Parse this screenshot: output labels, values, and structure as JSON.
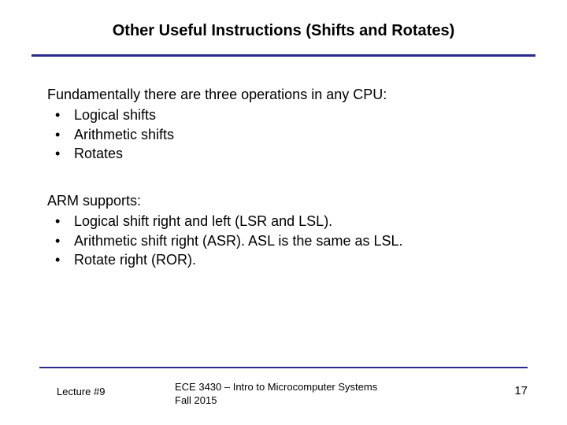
{
  "title": "Other Useful Instructions (Shifts and Rotates)",
  "section1": {
    "intro": "Fundamentally there are three operations in any CPU:",
    "bullets": [
      "Logical shifts",
      "Arithmetic shifts",
      "Rotates"
    ]
  },
  "section2": {
    "intro": "ARM supports:",
    "bullets": [
      "Logical shift right and left (LSR and LSL).",
      "Arithmetic shift right (ASR).  ASL is the same as LSL.",
      "Rotate right (ROR)."
    ]
  },
  "footer": {
    "lecture": "Lecture #9",
    "course_line1": "ECE 3430 – Intro to Microcomputer Systems",
    "course_line2": "Fall 2015",
    "page": "17"
  }
}
